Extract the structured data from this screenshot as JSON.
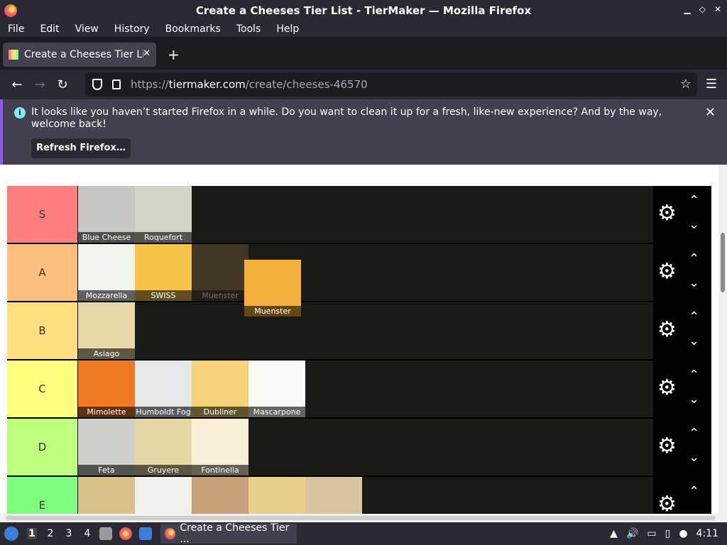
{
  "window": {
    "title": "Create a Cheeses Tier List - TierMaker — Mozilla Firefox"
  },
  "menu": [
    "File",
    "Edit",
    "View",
    "History",
    "Bookmarks",
    "Tools",
    "Help"
  ],
  "tab": {
    "label": "Create a Cheeses Tier List"
  },
  "url": {
    "host": "tiermaker.com",
    "prefix": "https://",
    "path": "/create/cheeses-46570"
  },
  "notice": {
    "message": "It looks like you haven’t started Firefox in a while. Do you want to clean it up for a fresh, like-new experience? And by the way, welcome back!",
    "button": "Refresh Firefox…"
  },
  "tiers": [
    {
      "label": "S",
      "color": "#ff7f7f",
      "items": [
        {
          "name": "Blue Cheese",
          "bg": "#c9c7c3"
        },
        {
          "name": "Roquefort",
          "bg": "#d6d2c6"
        }
      ]
    },
    {
      "label": "A",
      "color": "#ffbf7f",
      "items": [
        {
          "name": "Mozzarella",
          "bg": "#f2f2ee"
        },
        {
          "name": "SWISS",
          "bg": "#f5c24a"
        },
        {
          "name": "Muenster",
          "bg": "#8b6a3b",
          "dim": true
        }
      ]
    },
    {
      "label": "B",
      "color": "#ffdf7f",
      "items": [
        {
          "name": "Asiago",
          "bg": "#e9d9a8"
        }
      ]
    },
    {
      "label": "C",
      "color": "#ffff7f",
      "items": [
        {
          "name": "Mimolette",
          "bg": "#f07a24"
        },
        {
          "name": "Humboldt Fog",
          "bg": "#e6e9ea"
        },
        {
          "name": "Dubliner",
          "bg": "#f3d27a"
        },
        {
          "name": "Mascarpone",
          "bg": "#fafaf8"
        }
      ]
    },
    {
      "label": "D",
      "color": "#bfff7f",
      "items": [
        {
          "name": "Feta",
          "bg": "#cfcfcc"
        },
        {
          "name": "Gruyere",
          "bg": "#e6d7a4"
        },
        {
          "name": "Fontinella",
          "bg": "#f7efd6"
        }
      ]
    },
    {
      "label": "E",
      "color": "#7fff7f",
      "items": [
        {
          "name": "",
          "bg": "#d8c28a"
        },
        {
          "name": "",
          "bg": "#f0f0ec"
        },
        {
          "name": "",
          "bg": "#c9a27a"
        },
        {
          "name": "",
          "bg": "#e8d08a"
        },
        {
          "name": "",
          "bg": "#d9c4a0"
        }
      ]
    }
  ],
  "floating_item": {
    "name": "Muenster",
    "bg": "#f4b13b"
  },
  "taskbar": {
    "workspaces": [
      "1",
      "2",
      "3",
      "4"
    ],
    "active_task": "Create a Cheeses Tier ...",
    "clock": "4:11"
  }
}
